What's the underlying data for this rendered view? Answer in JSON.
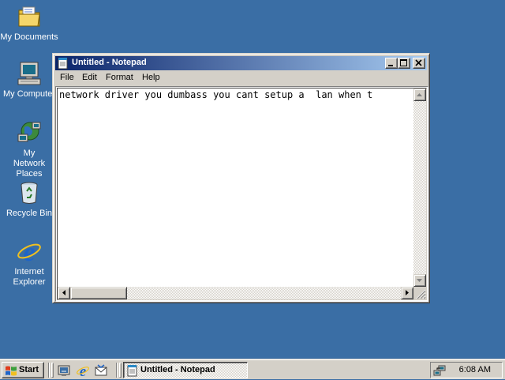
{
  "desktop": {
    "background": "#3a6ea5",
    "icons": [
      {
        "label": "My Documents",
        "icon": "folder-documents-icon"
      },
      {
        "label": "My Computer",
        "icon": "computer-icon"
      },
      {
        "label": "My Network Places",
        "icon": "network-icon"
      },
      {
        "label": "Recycle Bin",
        "icon": "recycle-bin-icon"
      },
      {
        "label": "Internet Explorer",
        "icon": "internet-explorer-icon"
      }
    ]
  },
  "window": {
    "title": "Untitled - Notepad",
    "menu": [
      "File",
      "Edit",
      "Format",
      "Help"
    ],
    "text": "network driver you dumbass you cant setup a  lan when t",
    "title_gradient": [
      "#0a246a",
      "#a6caf0"
    ]
  },
  "taskbar": {
    "start_label": "Start",
    "quick_launch": [
      "show-desktop-icon",
      "internet-explorer-icon",
      "outlook-express-icon"
    ],
    "task_label": "Untitled - Notepad",
    "clock": "6:08 AM",
    "tray_icon": "network-connection-icon"
  }
}
